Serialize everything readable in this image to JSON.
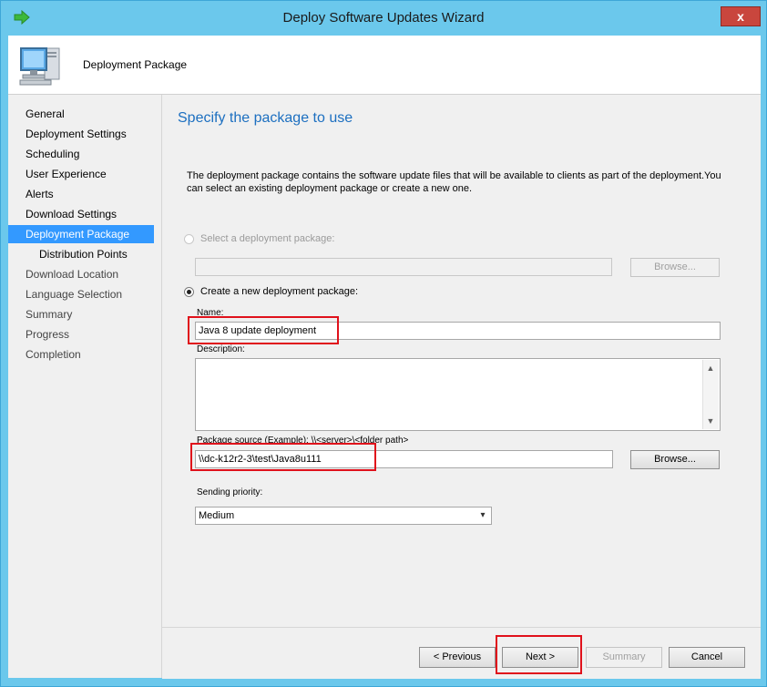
{
  "window": {
    "title": "Deploy Software Updates Wizard",
    "close_label": "x"
  },
  "header": {
    "title": "Deployment Package"
  },
  "nav": {
    "items": [
      {
        "label": "General"
      },
      {
        "label": "Deployment Settings"
      },
      {
        "label": "Scheduling"
      },
      {
        "label": "User Experience"
      },
      {
        "label": "Alerts"
      },
      {
        "label": "Download Settings"
      },
      {
        "label": "Deployment Package"
      },
      {
        "label": "Distribution Points"
      },
      {
        "label": "Download Location"
      },
      {
        "label": "Language Selection"
      },
      {
        "label": "Summary"
      },
      {
        "label": "Progress"
      },
      {
        "label": "Completion"
      }
    ]
  },
  "main": {
    "title": "Specify the package to use",
    "description": "The deployment package contains the software update files that will be available to clients as part of the deployment.You can select an existing deployment package or create a new one.",
    "existing": {
      "label": "Select a deployment package:",
      "value": "",
      "browse_label": "Browse..."
    },
    "new_package": {
      "label": "Create a new deployment package:",
      "name_label": "Name:",
      "name_value": "Java 8 update deployment",
      "description_label": "Description:",
      "description_value": "",
      "source_label": "Package source (Example): \\\\<server>\\<folder path>",
      "source_value": "\\\\dc-k12r2-3\\test\\Java8u111",
      "browse_label": "Browse...",
      "priority_label": "Sending priority:",
      "priority_value": "Medium"
    }
  },
  "footer": {
    "previous_label": "< Previous",
    "next_label": "Next >",
    "summary_label": "Summary",
    "cancel_label": "Cancel"
  },
  "colors": {
    "titlebar": "#6bc8ec",
    "nav_active": "#3399ff",
    "page_title": "#1c6fc0",
    "highlight_box": "#e0111b"
  }
}
